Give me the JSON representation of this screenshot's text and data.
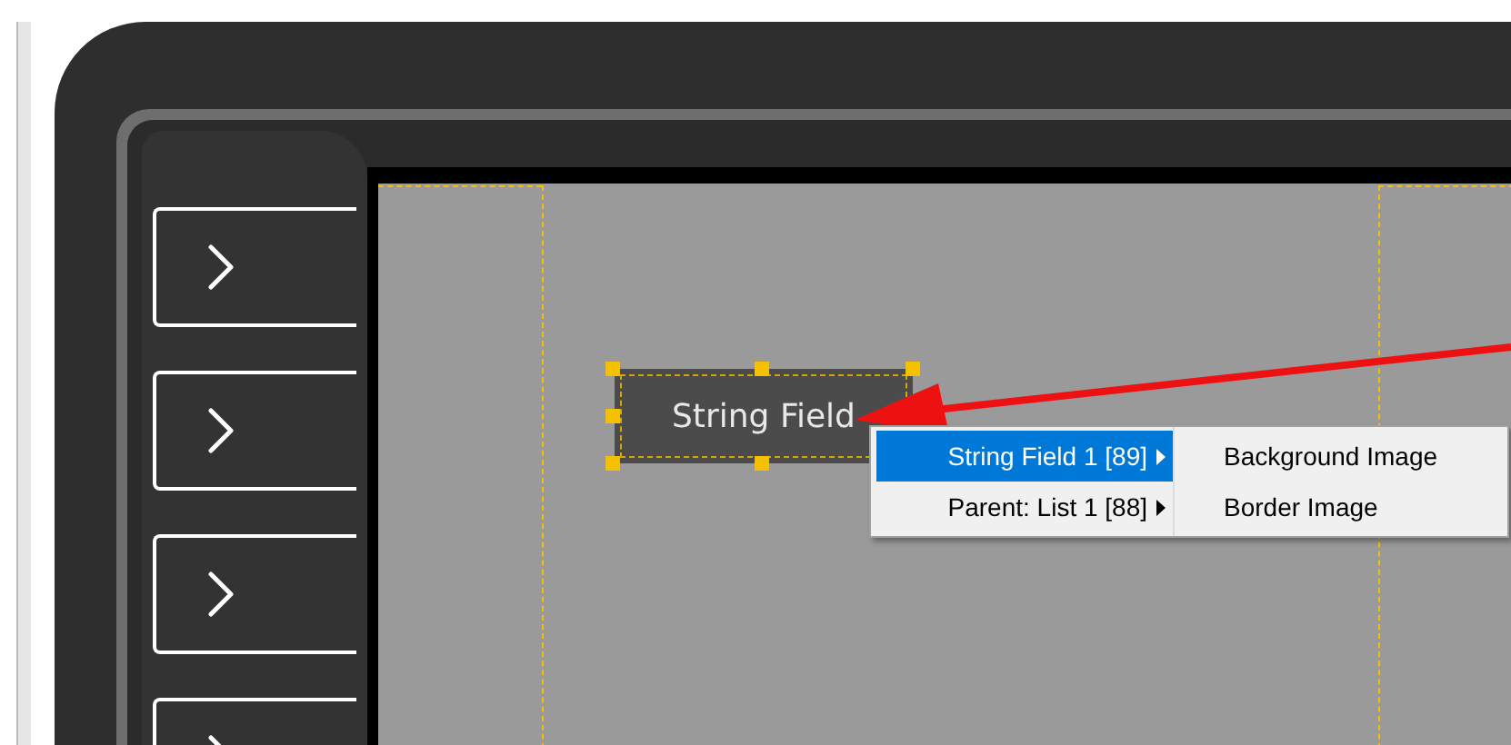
{
  "widget": {
    "label": "String Field"
  },
  "context_menu": {
    "items": [
      {
        "label": "String Field 1 [89]",
        "selected": true
      },
      {
        "label": "Parent: List 1 [88]",
        "selected": false
      }
    ],
    "submenu": [
      "Background Image",
      "Border Image"
    ]
  }
}
